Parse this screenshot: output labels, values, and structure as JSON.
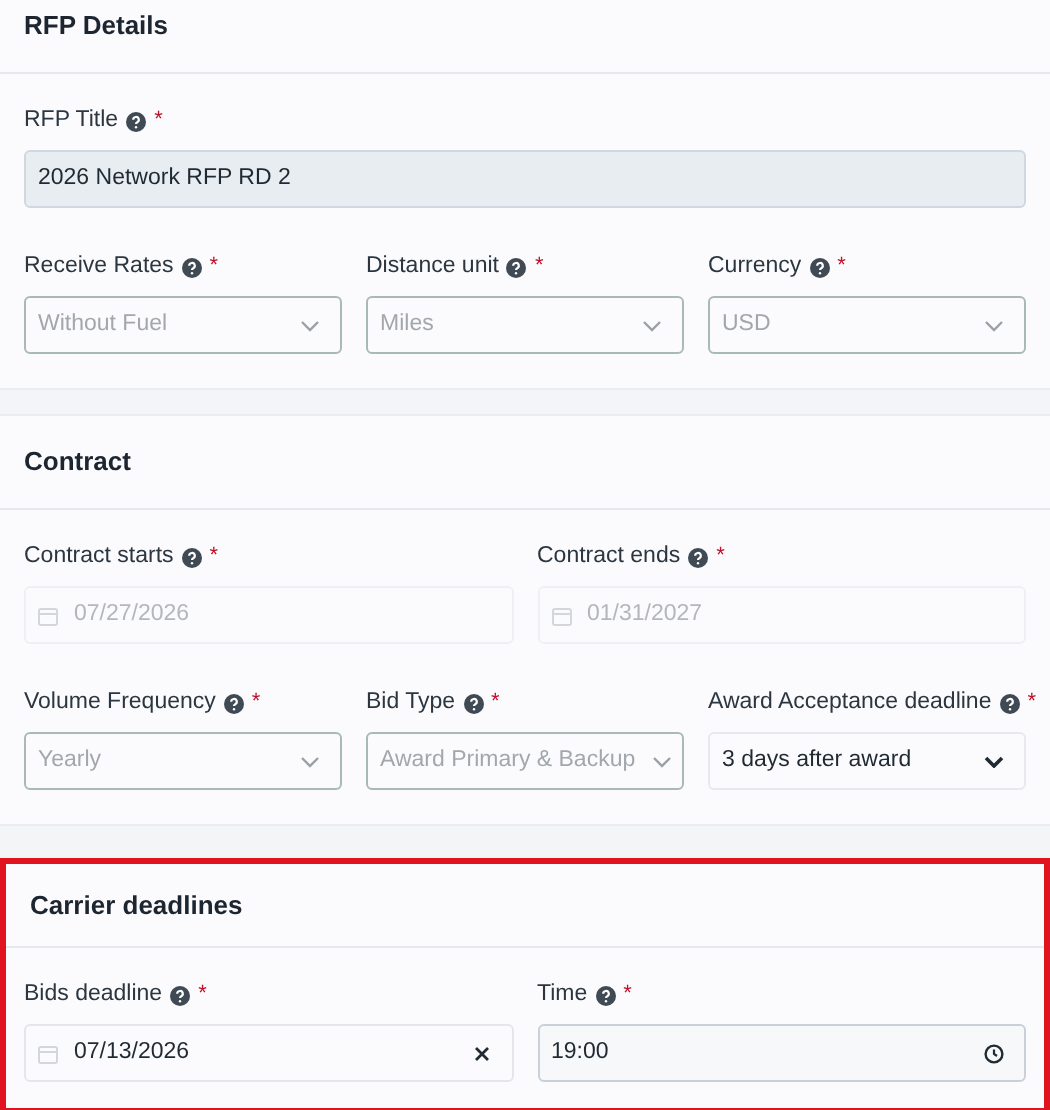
{
  "sections": [
    {
      "title": "RFP Details",
      "highlighted": false,
      "rows": [
        [
          {
            "label": "RFP Title",
            "required_mark": "*",
            "kind": "text",
            "value": "2026 Network RFP RD 2",
            "disabled": true
          }
        ],
        [
          {
            "label": "Receive Rates",
            "required_mark": "*",
            "kind": "select",
            "value": "Without Fuel",
            "disabled": true
          },
          {
            "label": "Distance unit",
            "required_mark": "*",
            "kind": "select",
            "value": "Miles",
            "disabled": true
          },
          {
            "label": "Currency",
            "required_mark": "*",
            "kind": "select",
            "value": "USD",
            "disabled": true
          }
        ]
      ]
    },
    {
      "title": "Contract",
      "highlighted": false,
      "rows": [
        [
          {
            "label": "Contract starts",
            "required_mark": "*",
            "kind": "date",
            "value": "07/27/2026",
            "disabled": true,
            "clearable": false
          },
          {
            "label": "Contract ends",
            "required_mark": "*",
            "kind": "date",
            "value": "01/31/2027",
            "disabled": true,
            "clearable": false
          }
        ],
        [
          {
            "label": "Volume Frequency",
            "required_mark": "*",
            "kind": "select",
            "value": "Yearly",
            "disabled": true
          },
          {
            "label": "Bid Type",
            "required_mark": "*",
            "kind": "select",
            "value": "Award Primary & Backup",
            "disabled": true
          },
          {
            "label": "Award Acceptance deadline",
            "required_mark": "*",
            "kind": "select",
            "value": "3 days after award",
            "disabled": false
          }
        ]
      ]
    },
    {
      "title": "Carrier deadlines",
      "highlighted": true,
      "rows": [
        [
          {
            "label": "Bids deadline",
            "required_mark": "*",
            "kind": "date",
            "value": "07/13/2026",
            "disabled": false,
            "clearable": true
          },
          {
            "label": "Time",
            "required_mark": "*",
            "kind": "time",
            "value": "19:00",
            "disabled": false
          }
        ]
      ]
    }
  ]
}
